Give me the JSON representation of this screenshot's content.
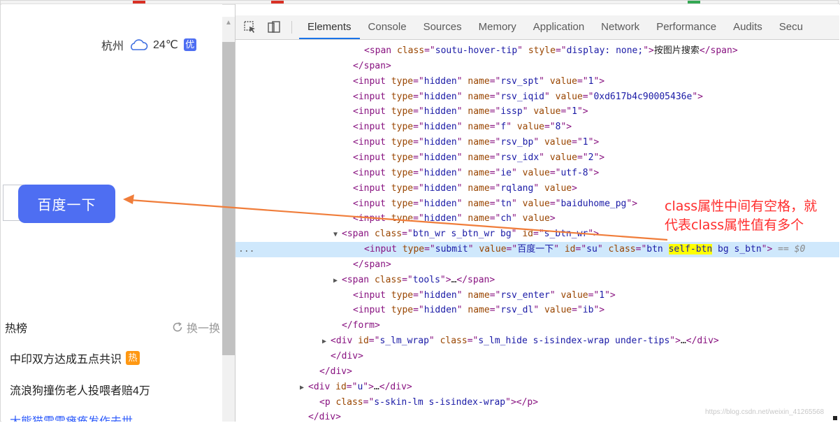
{
  "weather": {
    "city": "杭州",
    "temp": "24℃",
    "quality": "优"
  },
  "search": {
    "button_label": "百度一下"
  },
  "hotlist": {
    "title": "热榜",
    "refresh": "换一换",
    "items": [
      {
        "text": "中印双方达成五点共识",
        "badge": "热"
      },
      {
        "text": "流浪狗撞伤老人投喂者赔4万",
        "badge": ""
      },
      {
        "text": "大熊猫雷雷瘫痪发作去世",
        "badge": ""
      }
    ]
  },
  "devtools": {
    "tabs": [
      "Elements",
      "Console",
      "Sources",
      "Memory",
      "Application",
      "Network",
      "Performance",
      "Audits",
      "Secu"
    ],
    "active_tab": "Elements",
    "dom_lines": [
      {
        "indent": 10,
        "html": "<span class=\"tag\">&lt;span </span><span class=\"attr\">class</span><span class=\"tag\">=\"</span><span class=\"val\">soutu-hover-tip</span><span class=\"tag\">\" </span><span class=\"attr\">style</span><span class=\"tag\">=\"</span><span class=\"val\">display: none;</span><span class=\"tag\">\"&gt;</span><span class=\"txt\">按图片搜索</span><span class=\"tag\">&lt;/span&gt;</span>"
      },
      {
        "indent": 9,
        "html": "<span class=\"tag\">&lt;/span&gt;</span>"
      },
      {
        "indent": 9,
        "html": "<span class=\"tag\">&lt;input </span><span class=\"attr\">type</span><span class=\"tag\">=\"</span><span class=\"val\">hidden</span><span class=\"tag\">\" </span><span class=\"attr\">name</span><span class=\"tag\">=\"</span><span class=\"val\">rsv_spt</span><span class=\"tag\">\" </span><span class=\"attr\">value</span><span class=\"tag\">=\"</span><span class=\"val\">1</span><span class=\"tag\">\"&gt;</span>"
      },
      {
        "indent": 9,
        "html": "<span class=\"tag\">&lt;input </span><span class=\"attr\">type</span><span class=\"tag\">=\"</span><span class=\"val\">hidden</span><span class=\"tag\">\" </span><span class=\"attr\">name</span><span class=\"tag\">=\"</span><span class=\"val\">rsv_iqid</span><span class=\"tag\">\" </span><span class=\"attr\">value</span><span class=\"tag\">=\"</span><span class=\"val\">0xd617b4c90005436e</span><span class=\"tag\">\"&gt;</span>"
      },
      {
        "indent": 9,
        "html": "<span class=\"tag\">&lt;input </span><span class=\"attr\">type</span><span class=\"tag\">=\"</span><span class=\"val\">hidden</span><span class=\"tag\">\" </span><span class=\"attr\">name</span><span class=\"tag\">=\"</span><span class=\"val\">issp</span><span class=\"tag\">\" </span><span class=\"attr\">value</span><span class=\"tag\">=\"</span><span class=\"val\">1</span><span class=\"tag\">\"&gt;</span>"
      },
      {
        "indent": 9,
        "html": "<span class=\"tag\">&lt;input </span><span class=\"attr\">type</span><span class=\"tag\">=\"</span><span class=\"val\">hidden</span><span class=\"tag\">\" </span><span class=\"attr\">name</span><span class=\"tag\">=\"</span><span class=\"val\">f</span><span class=\"tag\">\" </span><span class=\"attr\">value</span><span class=\"tag\">=\"</span><span class=\"val\">8</span><span class=\"tag\">\"&gt;</span>"
      },
      {
        "indent": 9,
        "html": "<span class=\"tag\">&lt;input </span><span class=\"attr\">type</span><span class=\"tag\">=\"</span><span class=\"val\">hidden</span><span class=\"tag\">\" </span><span class=\"attr\">name</span><span class=\"tag\">=\"</span><span class=\"val\">rsv_bp</span><span class=\"tag\">\" </span><span class=\"attr\">value</span><span class=\"tag\">=\"</span><span class=\"val\">1</span><span class=\"tag\">\"&gt;</span>"
      },
      {
        "indent": 9,
        "html": "<span class=\"tag\">&lt;input </span><span class=\"attr\">type</span><span class=\"tag\">=\"</span><span class=\"val\">hidden</span><span class=\"tag\">\" </span><span class=\"attr\">name</span><span class=\"tag\">=\"</span><span class=\"val\">rsv_idx</span><span class=\"tag\">\" </span><span class=\"attr\">value</span><span class=\"tag\">=\"</span><span class=\"val\">2</span><span class=\"tag\">\"&gt;</span>"
      },
      {
        "indent": 9,
        "html": "<span class=\"tag\">&lt;input </span><span class=\"attr\">type</span><span class=\"tag\">=\"</span><span class=\"val\">hidden</span><span class=\"tag\">\" </span><span class=\"attr\">name</span><span class=\"tag\">=\"</span><span class=\"val\">ie</span><span class=\"tag\">\" </span><span class=\"attr\">value</span><span class=\"tag\">=\"</span><span class=\"val\">utf-8</span><span class=\"tag\">\"&gt;</span>"
      },
      {
        "indent": 9,
        "html": "<span class=\"tag\">&lt;input </span><span class=\"attr\">type</span><span class=\"tag\">=\"</span><span class=\"val\">hidden</span><span class=\"tag\">\" </span><span class=\"attr\">name</span><span class=\"tag\">=\"</span><span class=\"val\">rqlang</span><span class=\"tag\">\" </span><span class=\"attr\">value</span><span class=\"tag\">&gt;</span>"
      },
      {
        "indent": 9,
        "html": "<span class=\"tag\">&lt;input </span><span class=\"attr\">type</span><span class=\"tag\">=\"</span><span class=\"val\">hidden</span><span class=\"tag\">\" </span><span class=\"attr\">name</span><span class=\"tag\">=\"</span><span class=\"val\">tn</span><span class=\"tag\">\" </span><span class=\"attr\">value</span><span class=\"tag\">=\"</span><span class=\"val\">baiduhome_pg</span><span class=\"tag\">\"&gt;</span>"
      },
      {
        "indent": 9,
        "html": "<span class=\"tag\">&lt;input </span><span class=\"attr\">type</span><span class=\"tag\">=\"</span><span class=\"val\">hidden</span><span class=\"tag\">\" </span><span class=\"attr\">name</span><span class=\"tag\">=\"</span><span class=\"val\">ch</span><span class=\"tag\">\" </span><span class=\"attr\">value</span><span class=\"tag\">&gt;</span>"
      },
      {
        "indent": 8,
        "tri": "▼",
        "html": "<span class=\"tag\">&lt;span </span><span class=\"attr\">class</span><span class=\"tag\">=\"</span><span class=\"val\">btn_wr s_btn_wr bg</span><span class=\"tag\">\" </span><span class=\"attr\">id</span><span class=\"tag\">=\"</span><span class=\"val\">s_btn_wr</span><span class=\"tag\">\"&gt;</span>"
      },
      {
        "indent": 10,
        "selected": true,
        "html": "<span class=\"tag\">&lt;input </span><span class=\"attr\">type</span><span class=\"tag\">=\"</span><span class=\"val\">submit</span><span class=\"tag\">\" </span><span class=\"attr\">value</span><span class=\"tag\">=\"</span><span class=\"val\">百度一下</span><span class=\"tag\">\" </span><span class=\"attr\">id</span><span class=\"tag\">=\"</span><span class=\"val\">su</span><span class=\"tag\">\" </span><span class=\"attr\">class</span><span class=\"tag\">=\"</span><span class=\"val\">btn </span><span class=\"hl\">self-btn</span><span class=\"val\"> bg s_btn</span><span class=\"tag\">\"&gt;</span><span class=\"eq\"> == $0</span>"
      },
      {
        "indent": 9,
        "html": "<span class=\"tag\">&lt;/span&gt;</span>"
      },
      {
        "indent": 8,
        "tri": "▶",
        "html": "<span class=\"tag\">&lt;span </span><span class=\"attr\">class</span><span class=\"tag\">=\"</span><span class=\"val\">tools</span><span class=\"tag\">\"&gt;</span><span class=\"txt\">…</span><span class=\"tag\">&lt;/span&gt;</span>"
      },
      {
        "indent": 9,
        "html": "<span class=\"tag\">&lt;input </span><span class=\"attr\">type</span><span class=\"tag\">=\"</span><span class=\"val\">hidden</span><span class=\"tag\">\" </span><span class=\"attr\">name</span><span class=\"tag\">=\"</span><span class=\"val\">rsv_enter</span><span class=\"tag\">\" </span><span class=\"attr\">value</span><span class=\"tag\">=\"</span><span class=\"val\">1</span><span class=\"tag\">\"&gt;</span>"
      },
      {
        "indent": 9,
        "html": "<span class=\"tag\">&lt;input </span><span class=\"attr\">type</span><span class=\"tag\">=\"</span><span class=\"val\">hidden</span><span class=\"tag\">\" </span><span class=\"attr\">name</span><span class=\"tag\">=\"</span><span class=\"val\">rsv_dl</span><span class=\"tag\">\" </span><span class=\"attr\">value</span><span class=\"tag\">=\"</span><span class=\"val\">ib</span><span class=\"tag\">\"&gt;</span>"
      },
      {
        "indent": 8,
        "html": "<span class=\"tag\">&lt;/form&gt;</span>"
      },
      {
        "indent": 7,
        "tri": "▶",
        "html": "<span class=\"tag\">&lt;div </span><span class=\"attr\">id</span><span class=\"tag\">=\"</span><span class=\"val\">s_lm_wrap</span><span class=\"tag\">\" </span><span class=\"attr\">class</span><span class=\"tag\">=\"</span><span class=\"val\">s_lm_hide s-isindex-wrap under-tips</span><span class=\"tag\">\"&gt;</span><span class=\"txt\">…</span><span class=\"tag\">&lt;/div&gt;</span>"
      },
      {
        "indent": 7,
        "html": "<span class=\"tag\">&lt;/div&gt;</span>"
      },
      {
        "indent": 6,
        "html": "<span class=\"tag\">&lt;/div&gt;</span>"
      },
      {
        "indent": 5,
        "tri": "▶",
        "html": "<span class=\"tag\">&lt;div </span><span class=\"attr\">id</span><span class=\"tag\">=\"</span><span class=\"val\">u</span><span class=\"tag\">\"&gt;</span><span class=\"txt\">…</span><span class=\"tag\">&lt;/div&gt;</span>"
      },
      {
        "indent": 6,
        "html": "<span class=\"tag\">&lt;p </span><span class=\"attr\">class</span><span class=\"tag\">=\"</span><span class=\"val\">s-skin-lm s-isindex-wrap</span><span class=\"tag\">\"&gt;&lt;/p&gt;</span>"
      },
      {
        "indent": 5,
        "html": "<span class=\"tag\">&lt;/div&gt;</span>"
      }
    ],
    "selected_dots": "...",
    "annotation": [
      "class属性中间有空格，就",
      "代表class属性值有多个"
    ],
    "watermark": "https://blog.csdn.net/weixin_41265568"
  },
  "colors": {
    "accent": "#4e6ef2",
    "annotation": "#ff2d2d",
    "arrow": "#f07d3a",
    "selection": "#cfe8fc"
  }
}
